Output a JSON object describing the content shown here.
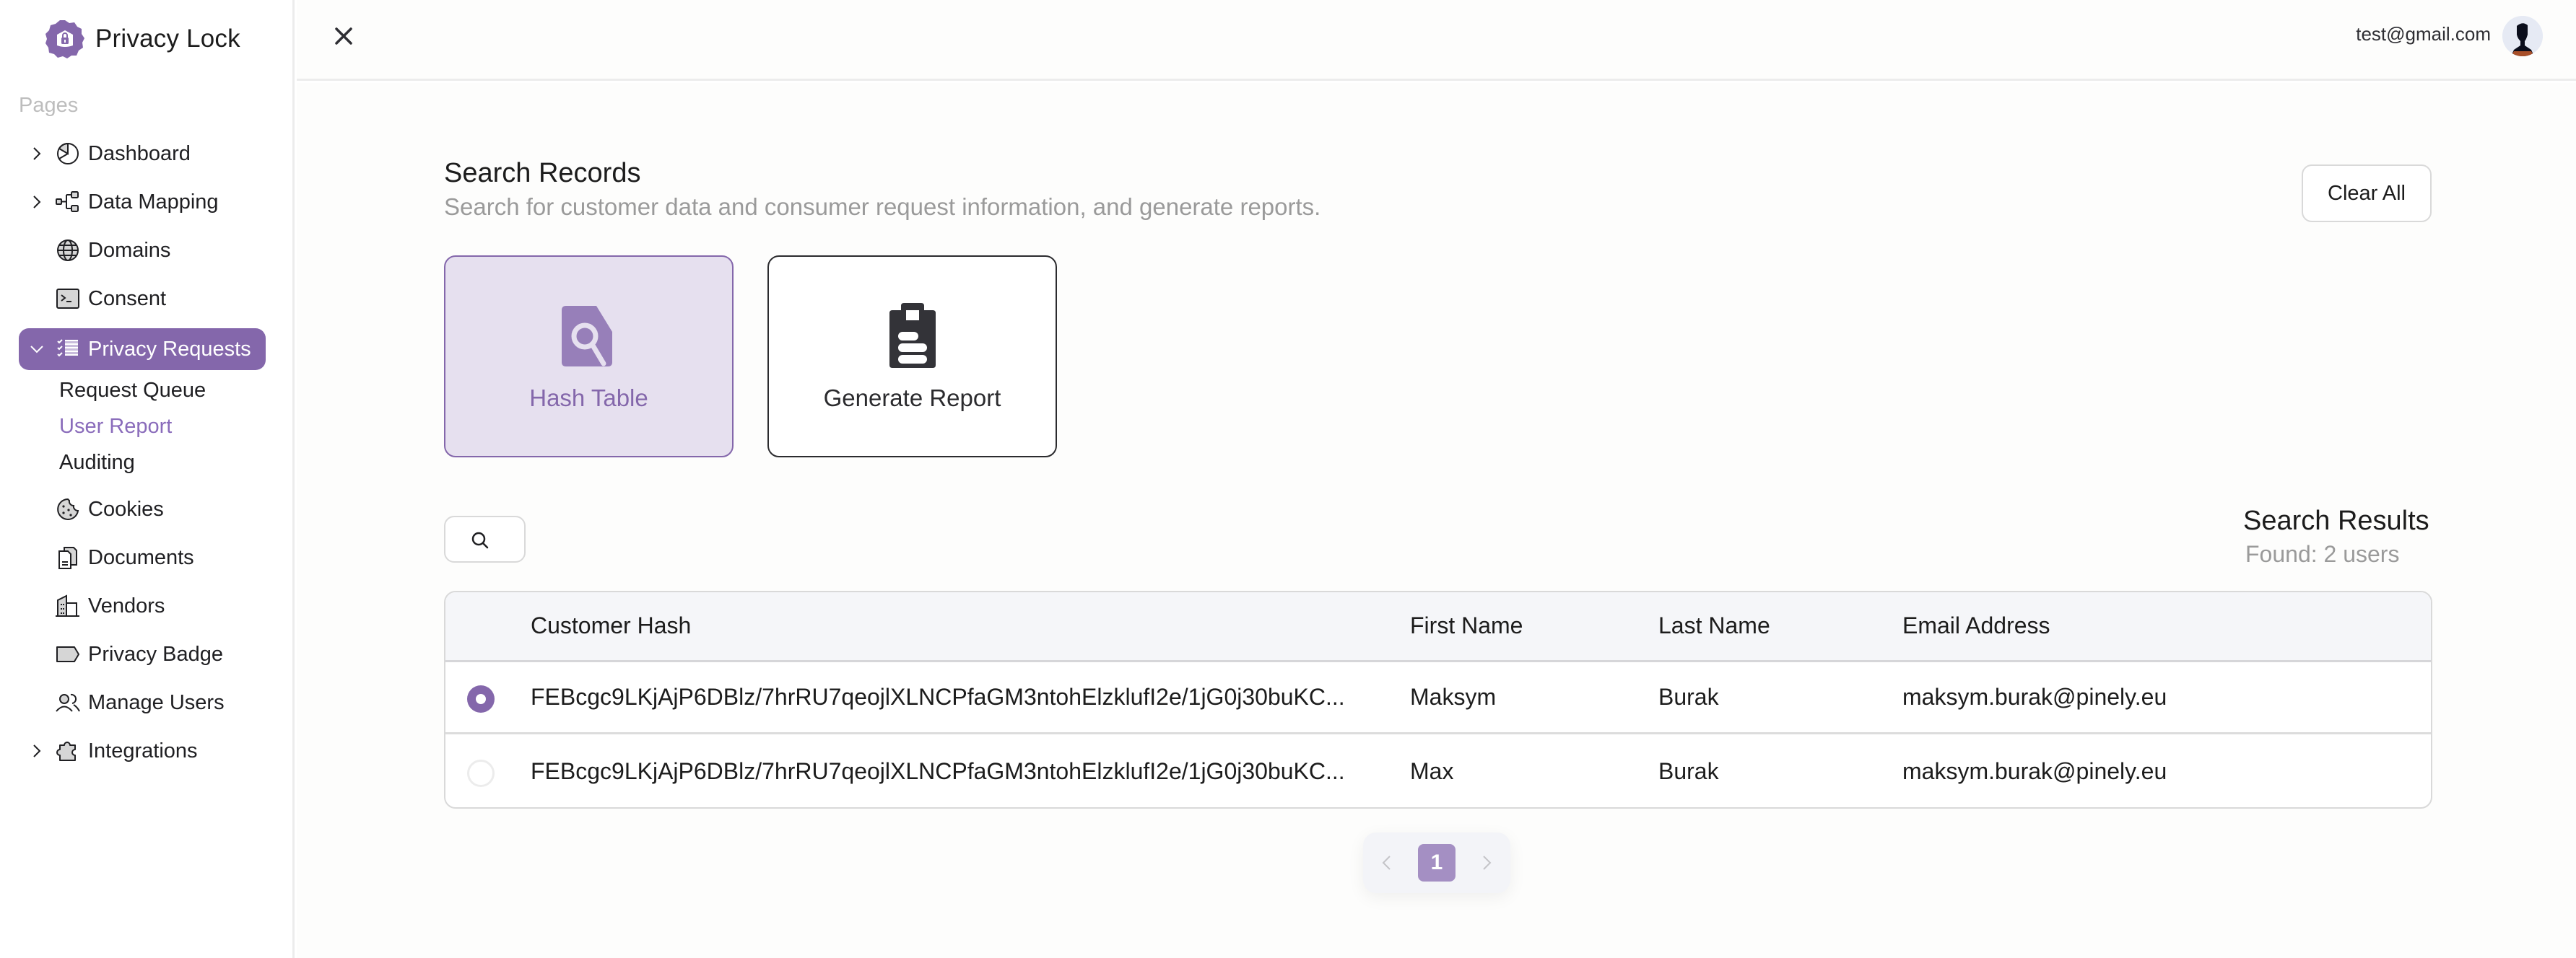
{
  "app": {
    "name": "Privacy Lock",
    "brand_color": "#8467ab"
  },
  "sidebar": {
    "section_label": "Pages",
    "items": [
      {
        "label": "Dashboard",
        "icon": "pie-chart-icon",
        "expandable": true
      },
      {
        "label": "Data Mapping",
        "icon": "tree-structure-icon",
        "expandable": true
      },
      {
        "label": "Domains",
        "icon": "globe-icon",
        "expandable": false
      },
      {
        "label": "Consent",
        "icon": "terminal-window-icon",
        "expandable": false
      },
      {
        "label": "Privacy Requests",
        "icon": "list-checks-icon",
        "expandable": true,
        "expanded": true,
        "active": true
      },
      {
        "label": "Cookies",
        "icon": "cookie-icon",
        "expandable": false
      },
      {
        "label": "Documents",
        "icon": "files-icon",
        "expandable": false
      },
      {
        "label": "Vendors",
        "icon": "buildings-icon",
        "expandable": false
      },
      {
        "label": "Privacy Badge",
        "icon": "tag-icon",
        "expandable": false
      },
      {
        "label": "Manage Users",
        "icon": "users-icon",
        "expandable": false
      },
      {
        "label": "Integrations",
        "icon": "puzzle-piece-icon",
        "expandable": true
      }
    ],
    "sub_items": [
      {
        "label": "Request Queue"
      },
      {
        "label": "User Report",
        "current": true
      },
      {
        "label": "Auditing"
      }
    ]
  },
  "topbar": {
    "close_icon": "close-icon",
    "user_email": "test@gmail.com"
  },
  "main": {
    "title": "Search Records",
    "subtitle": "Search for customer data and consumer request information, and generate reports.",
    "clear_all_label": "Clear All",
    "tiles": [
      {
        "label": "Hash Table",
        "icon": "file-search-icon",
        "selected": true
      },
      {
        "label": "Generate Report",
        "icon": "clipboard-text-icon",
        "selected": false
      }
    ],
    "search": {
      "value": "",
      "placeholder": ""
    },
    "results": {
      "title": "Search Results",
      "count_text": "Found: 2 users"
    },
    "table": {
      "columns": [
        "",
        "Customer Hash",
        "First Name",
        "Last Name",
        "Email Address"
      ],
      "rows": [
        {
          "selected": true,
          "hash": "FEBcgc9LKjAjP6DBlz/7hrRU7qeojlXLNCPfaGM3ntohElzklufI2e/1jG0j30buKC...",
          "first_name": "Maksym",
          "last_name": "Burak",
          "email": "maksym.burak@pinely.eu"
        },
        {
          "selected": false,
          "hash": "FEBcgc9LKjAjP6DBlz/7hrRU7qeojlXLNCPfaGM3ntohElzklufI2e/1jG0j30buKC...",
          "first_name": "Max",
          "last_name": "Burak",
          "email": "maksym.burak@pinely.eu"
        }
      ]
    },
    "pagination": {
      "current_page": "1",
      "prev_disabled": true,
      "next_disabled": true
    }
  }
}
